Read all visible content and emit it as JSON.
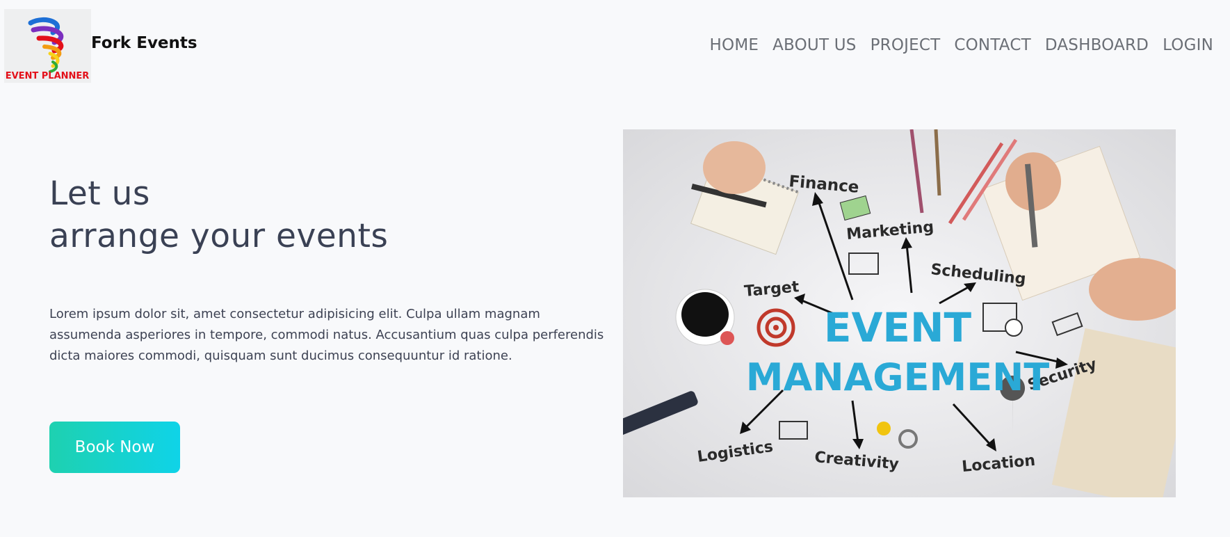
{
  "brand": {
    "logo_text": "EVENT PLANNER",
    "name": "Fork Events"
  },
  "nav": {
    "items": [
      {
        "label": "HOME"
      },
      {
        "label": "ABOUT US"
      },
      {
        "label": "PROJECT"
      },
      {
        "label": "CONTACT"
      },
      {
        "label": "DASHBOARD"
      },
      {
        "label": "LOGIN"
      }
    ]
  },
  "hero": {
    "title_line1": "Let us",
    "title_line2": "arrange your events",
    "description": "Lorem ipsum dolor sit, amet consectetur adipisicing elit. Culpa ullam magnam assumenda asperiores in tempore, commodi natus. Accusantium quas culpa perferendis dicta maiores commodi, quisquam sunt ducimus consequuntur id ratione.",
    "button_label": "Book Now"
  },
  "image": {
    "main_line1": "EVENT",
    "main_line2": "MANAGEMENT",
    "labels": {
      "finance": "Finance",
      "marketing": "Marketing",
      "scheduling": "Scheduling",
      "target": "Target",
      "security": "Security",
      "logistics": "Logistics",
      "creativity": "Creativity",
      "location": "Location"
    }
  },
  "colors": {
    "background": "#f8f9fb",
    "button_gradient_start": "#1ed1b0",
    "button_gradient_end": "#0fd3e8",
    "main_word": "#2aa9d6",
    "logo_text": "#e3101a"
  }
}
